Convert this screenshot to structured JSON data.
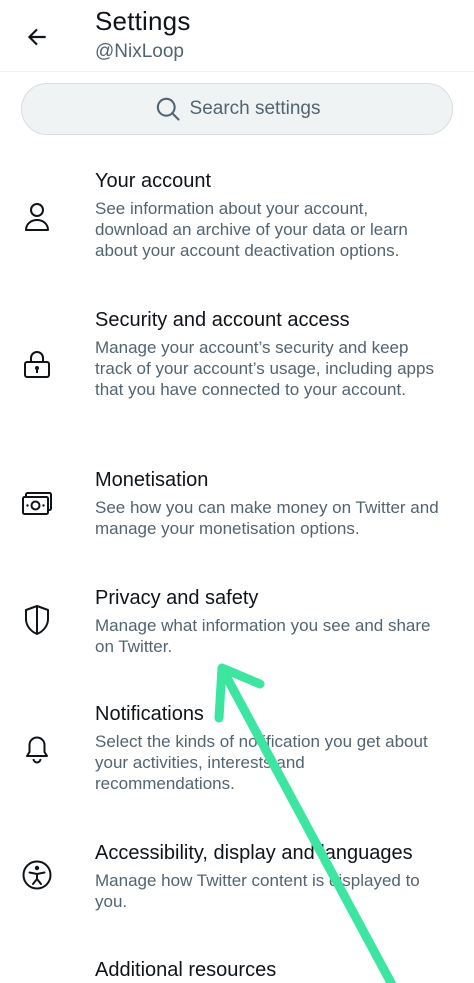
{
  "header": {
    "title": "Settings",
    "handle": "@NixLoop",
    "back_icon": "arrow-left-icon"
  },
  "search": {
    "placeholder": "Search settings",
    "icon": "search-icon"
  },
  "items": [
    {
      "icon": "person-icon",
      "title": "Your account",
      "description": "See information about your account, download an archive of your data or learn about your account deactivation options."
    },
    {
      "icon": "lock-icon",
      "title": "Security and account access",
      "description": "Manage your account’s security and keep track of your account’s usage, including apps that you have connected to your account."
    },
    {
      "icon": "money-icon",
      "title": "Monetisation",
      "description": "See how you can make money on Twitter and manage your monetisation options."
    },
    {
      "icon": "shield-icon",
      "title": "Privacy and safety",
      "description": "Manage what information you see and share on Twitter."
    },
    {
      "icon": "bell-icon",
      "title": "Notifications",
      "description": "Select the kinds of notification you get about your activities, interests and recommendations."
    },
    {
      "icon": "accessibility-icon",
      "title": "Accessibility, display and languages",
      "description": "Manage how Twitter content is displayed to you."
    },
    {
      "icon": "",
      "title": "Additional resources",
      "description": ""
    }
  ],
  "colors": {
    "text": "#0f1419",
    "secondary": "#536471",
    "search_bg": "#eff3f4",
    "annotation_arrow": "#3ce6a0"
  }
}
